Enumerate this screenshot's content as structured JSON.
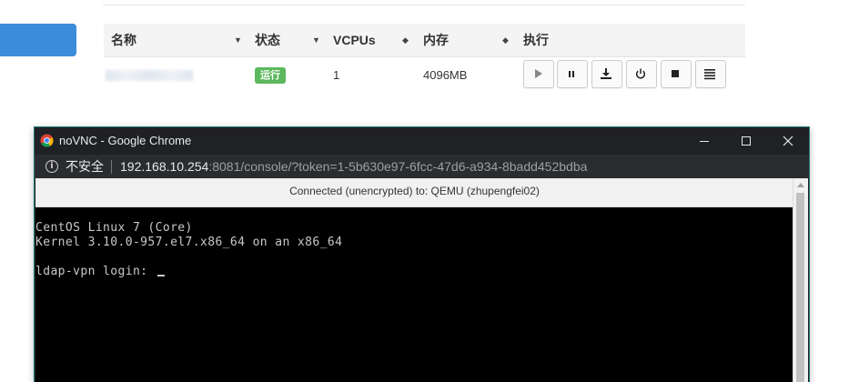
{
  "table": {
    "headers": {
      "name": "名称",
      "status": "状态",
      "vcpus": "VCPUs",
      "memory": "内存",
      "actions": "执行"
    },
    "sort_icons": {
      "name": "▼",
      "status": "▼",
      "vcpus": "◆",
      "memory": "◆"
    },
    "row": {
      "status": "运行",
      "vcpus": "1",
      "memory": "4096MB"
    },
    "action_icons": [
      "play-icon",
      "pause-icon",
      "download-icon",
      "power-icon",
      "stop-icon",
      "menu-icon"
    ],
    "colors": {
      "accent_blue": "#3c8dd9",
      "status_green": "#5cb85c"
    }
  },
  "window": {
    "title": "noVNC - Google Chrome",
    "insecure_label": "不安全",
    "url_host": "192.168.10.254",
    "url_rest": ":8081/console/?token=1-5b630e97-6fcc-47d6-a934-8badd452bdba",
    "controls": [
      "minimize-icon",
      "maximize-icon",
      "close-icon"
    ]
  },
  "vnc": {
    "status": "Connected (unencrypted) to: QEMU (zhupengfei02)",
    "lines": {
      "l1": "CentOS Linux 7 (Core)",
      "l2": "Kernel 3.10.0-957.el7.x86_64 on an x86_64",
      "l3": "ldap-vpn login: "
    }
  }
}
